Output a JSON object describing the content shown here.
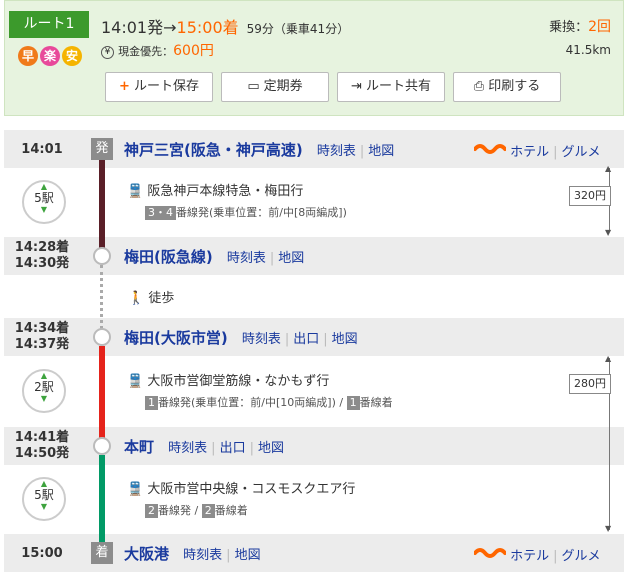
{
  "route": {
    "label": "ルート1",
    "icons": [
      {
        "char": "早",
        "color": "#f07a1a"
      },
      {
        "char": "楽",
        "color": "#e8499a"
      },
      {
        "char": "安",
        "color": "#f5b400"
      }
    ],
    "depart": "14:01発",
    "arrow": "→",
    "arrive": "15:00着",
    "duration": "59分（乗車41分）",
    "fare_label": "現金優先：",
    "fare_value": "600円",
    "yen_mark": "¥",
    "transfer_label": "乗換：",
    "transfer_count": "2回",
    "distance": "41.5km"
  },
  "buttons": {
    "save": "ルート保存",
    "teiki": "定期券",
    "share": "ルート共有",
    "print": "印刷する"
  },
  "stations": [
    {
      "time": "14:01",
      "tag": "発",
      "name": "神戸三宮(阪急・神戸高速)",
      "links": [
        "時刻表",
        "地図"
      ],
      "extras": [
        "ホテル",
        "グルメ"
      ]
    },
    {
      "time_arr": "14:28着",
      "time_dep": "14:30発",
      "name": "梅田(阪急線)",
      "links": [
        "時刻表",
        "地図"
      ]
    },
    {
      "time_arr": "14:34着",
      "time_dep": "14:37発",
      "name": "梅田(大阪市営)",
      "links": [
        "時刻表",
        "出口",
        "地図"
      ]
    },
    {
      "time_arr": "14:41着",
      "time_dep": "14:50発",
      "name": "本町",
      "links": [
        "時刻表",
        "出口",
        "地図"
      ]
    },
    {
      "time": "15:00",
      "tag": "着",
      "name": "大阪港",
      "links": [
        "時刻表",
        "地図"
      ],
      "extras": [
        "ホテル",
        "グルメ"
      ]
    }
  ],
  "segments": [
    {
      "stops": "5駅",
      "train": "阪急神戸本線特急・梅田行",
      "plat_num": "3・4",
      "plat_text": "番線発(乗車位置：前/中[8両編成])",
      "color": "#5a1f28"
    },
    {
      "walk": "徒歩"
    },
    {
      "stops": "2駅",
      "train": "大阪市営御堂筋線・なかもず行",
      "plat_num": "1",
      "plat_text": "番線発(乗車位置：前/中[10両編成])",
      "plat_sep": " / ",
      "plat_num2": "1",
      "plat_text2": "番線着",
      "color": "#e5231b"
    },
    {
      "stops": "5駅",
      "train": "大阪市営中央線・コスモスクエア行",
      "plat_num": "2",
      "plat_text": "番線発",
      "plat_sep": " / ",
      "plat_num2": "2",
      "plat_text2": "番線着",
      "color": "#019a66"
    }
  ],
  "fares": [
    "320円",
    "280円"
  ],
  "colors": {
    "accent": "#ff6600",
    "link": "#1a3a9e",
    "header_bg": "#e7f3df",
    "badge": "#3c9a2c"
  }
}
